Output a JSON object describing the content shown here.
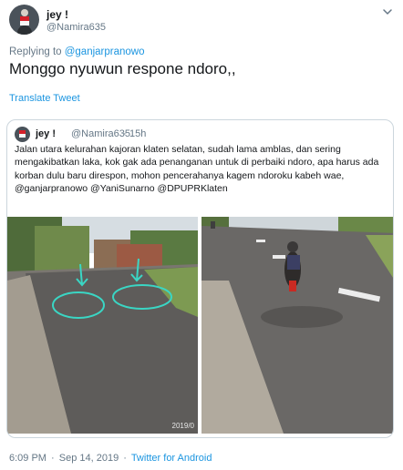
{
  "author": {
    "name": "jey !",
    "handle": "@Namira635"
  },
  "reply": {
    "prefix": "Replying to ",
    "mention": "@ganjarpranowo"
  },
  "tweet_text": "Monggo nyuwun respone ndoro,,",
  "translate_label": "Translate Tweet",
  "quoted": {
    "name": "jey !",
    "handle": "@Namira635",
    "dot": "·",
    "time": "15h",
    "text": "Jalan utara kelurahan kajoran klaten selatan, sudah lama amblas, dan sering mengakibatkan laka, kok gak ada penanganan untuk di perbaiki ndoro, apa harus ada korban dulu baru direspon, mohon pencerahanya kagem ndoroku kabeh wae, @ganjarpranowo @YaniSunarno @DPUPRKlaten",
    "image_watermark": "2019/0"
  },
  "footer": {
    "time": "6:09 PM",
    "separator1": "·",
    "date": "Sep 14, 2019",
    "separator2": "·",
    "source": "Twitter for Android"
  },
  "colors": {
    "link": "#1b95e0",
    "secondary_text": "#657786",
    "primary_text": "#14171a",
    "border": "#ccd6dd",
    "annotation": "#3ad6c4"
  },
  "icons": {
    "more": "chevron-down-icon"
  }
}
